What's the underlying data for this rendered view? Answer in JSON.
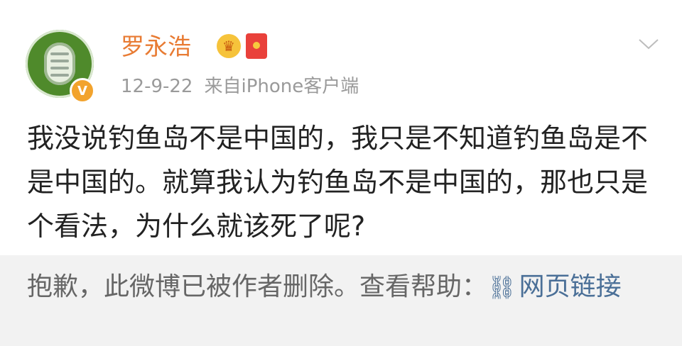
{
  "post": {
    "username": "罗永浩",
    "date": "12-9-22",
    "source": "来自iPhone客户端",
    "text": "我没说钓鱼岛不是中国的，我只是不知道钓鱼岛是不是中国的。就算我认为钓鱼岛不是中国的，那也只是个看法，为什么就该死了呢?",
    "badge": "V",
    "icons": [
      "avatar",
      "verified-badge-icon",
      "crown-member-icon",
      "red-packet-icon",
      "chevron-down-icon"
    ]
  },
  "deleted_notice": {
    "text": "抱歉，此微博已被作者删除。查看帮助：",
    "link_icon": "link-icon",
    "link_label": "网页链接"
  },
  "colors": {
    "username": "#e87b33",
    "meta": "#9a9a9a",
    "body_text": "#222222",
    "notice_bg": "#f2f2f2",
    "notice_text": "#666666",
    "link": "#4a6f97"
  }
}
